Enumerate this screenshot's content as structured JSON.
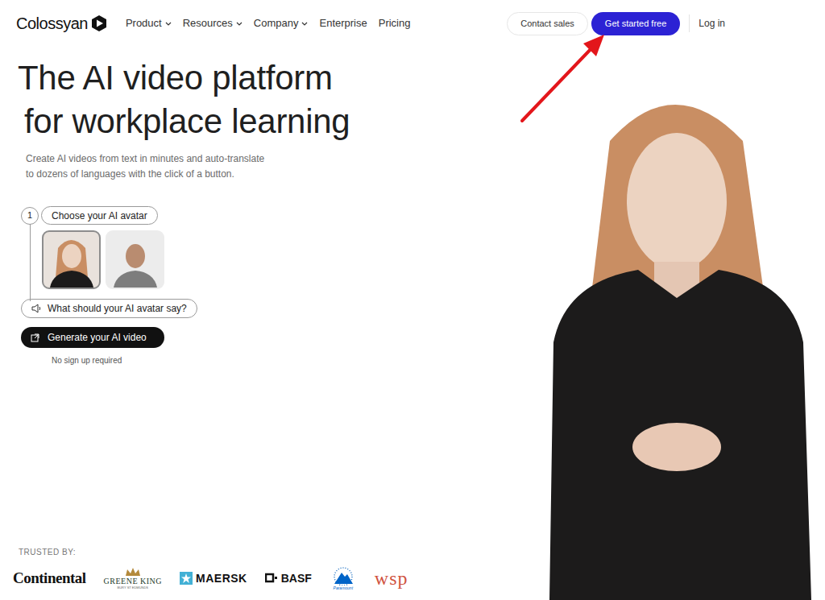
{
  "nav": {
    "logo": "Colossyan",
    "menu": [
      {
        "label": "Product",
        "dropdown": true
      },
      {
        "label": "Resources",
        "dropdown": true
      },
      {
        "label": "Company",
        "dropdown": true
      },
      {
        "label": "Enterprise",
        "dropdown": false
      },
      {
        "label": "Pricing",
        "dropdown": false
      }
    ],
    "contact": "Contact sales",
    "cta": "Get started free",
    "login": "Log in"
  },
  "hero": {
    "title_lines": [
      "The AI video platform",
      "for workplace learning"
    ],
    "subtitle_lines": [
      "Create AI videos from text in minutes and auto-translate",
      "to dozens of languages with the click of a button."
    ]
  },
  "step": {
    "number": "1",
    "label": "Choose your AI avatar",
    "avatars": [
      {
        "selected": true
      },
      {
        "selected": false
      }
    ],
    "prompt": "What should your AI avatar say?",
    "button": "Generate your AI video",
    "note": "No sign up required"
  },
  "trusted": {
    "label": "TRUSTED BY:",
    "logos": [
      {
        "kind": "continental",
        "text": "Continental"
      },
      {
        "kind": "greeneking",
        "text": "GREENE KING",
        "sub": "BURY ST EDMUNDS"
      },
      {
        "kind": "maersk",
        "text": "MAERSK"
      },
      {
        "kind": "basf",
        "text": "BASF"
      },
      {
        "kind": "paramount",
        "text": "Paramount"
      },
      {
        "kind": "wsp",
        "text": "wsp"
      }
    ]
  }
}
